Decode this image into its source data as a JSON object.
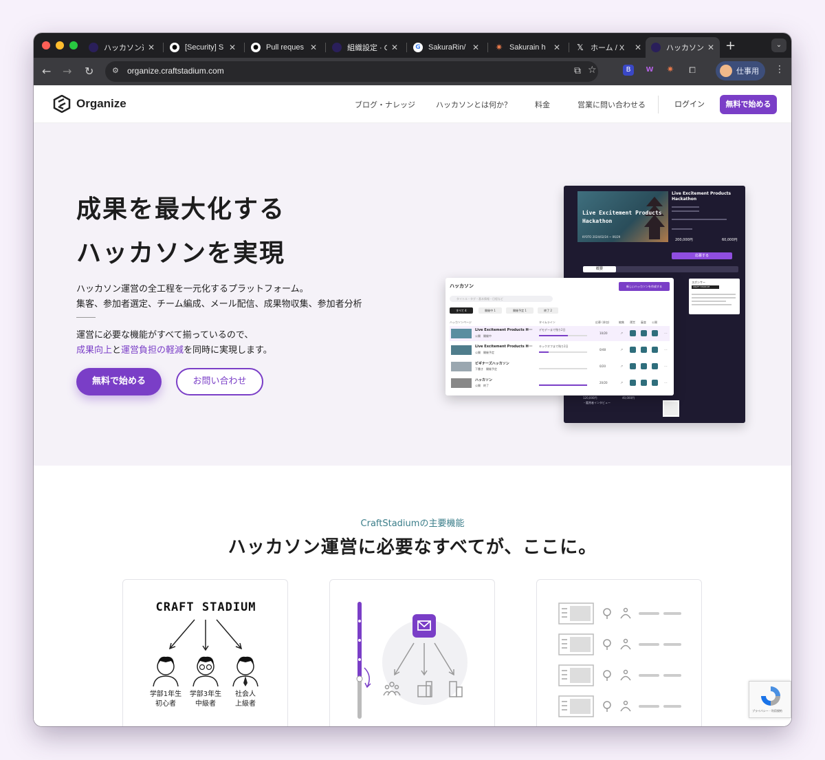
{
  "browser": {
    "tabs": [
      {
        "label": "ハッカソン運",
        "favicon_color": "#2a1f5a"
      },
      {
        "label": "[Security] S",
        "favicon_color": "#ffffff"
      },
      {
        "label": "Pull reques",
        "favicon_color": "#ffffff"
      },
      {
        "label": "組織設定 · C",
        "favicon_color": "#2a1f5a"
      },
      {
        "label": "SakuraRin/",
        "favicon_color": "#ffffff"
      },
      {
        "label": "Sakurain h",
        "favicon_color": "#e8794a"
      },
      {
        "label": "ホーム / X",
        "favicon_color": "#ffffff"
      },
      {
        "label": "ハッカソン運",
        "favicon_color": "#2a1f5a"
      }
    ],
    "active_tab_index": 7,
    "url": "organize.craftstadium.com",
    "profile_label": "仕事用"
  },
  "site": {
    "logo_text": "Organize",
    "nav": [
      "ブログ・ナレッジ",
      "ハッカソンとは何か？",
      "料金",
      "営業に問い合わせる"
    ],
    "login_label": "ログイン",
    "signup_label": "無料で始める",
    "accent_color": "#7a3ec7"
  },
  "hero": {
    "title_line1": "成果を最大化する",
    "title_line2": "ハッカソンを実現",
    "desc_line1": "ハッカソン運営の全工程を一元化するプラットフォーム。",
    "desc_line2": "集客、参加者選定、チーム編成、メール配信、成果物収集、参加者分析",
    "benefit_line1": "運営に必要な機能がすべて揃っているので、",
    "benefit_part_a": "成果向上",
    "benefit_part_b": "と",
    "benefit_part_c": "運営負担の軽減",
    "benefit_part_d": "を同時に実現します。",
    "cta_primary": "無料で始める",
    "cta_secondary": "お問い合わせ"
  },
  "mock_event": {
    "banner_text": "Live Excitement Products Hackathon",
    "title": "Live Excitement Products Hackathon",
    "join_label": "応募する",
    "tab_overview": "概要",
    "prize_1": "200,000円",
    "prize_2": "60,000円",
    "bottom_1": "120,000円",
    "bottom_2": "40,000円",
    "side_title": "スポンサー",
    "side_brand": "CRAFT STADIUM",
    "interview": "・鑑賞者インタビュー",
    "hold_date": "KYOTO 2024/02/24 ~ 06/29"
  },
  "mock_list": {
    "title": "ハッカソン",
    "new_button": "新しいハッカソンを作成する",
    "search_placeholder": "タイトル・タグ・基本情報・日程など",
    "filters": [
      "すべて 4",
      "開催中 1",
      "開催予定 1",
      "終了 2"
    ],
    "headers": [
      "ハッカソンページ",
      "タイムライン",
      "応募 (参加)",
      "編集",
      "運営",
      "審査",
      "公開"
    ],
    "rows": [
      {
        "name": "Live Excitement Products H···",
        "sub": "公開　開催中",
        "status": "デモデーまで残り2日",
        "count": "10/20",
        "progress": 0.6
      },
      {
        "name": "Live Excitement Products H···",
        "sub": "公開　開催予定",
        "status": "キックオフまで残り2日",
        "count": "0/48",
        "progress": 0.2
      },
      {
        "name": "ビギナーズハッカソン",
        "sub": "下書き　開催予定",
        "status": "",
        "count": "0/20",
        "progress": 0.0
      },
      {
        "name": "ハッカソン",
        "sub": "公開　終了",
        "status": "",
        "count": "20/20",
        "progress": 1.0
      }
    ]
  },
  "features": {
    "eyebrow": "CraftStadiumの主要機能",
    "title": "ハッカソン運営に必要なすべてが、ここに。",
    "card1_brand": "CRAFT STADIUM",
    "card1_people": [
      {
        "line1": "学部1年生",
        "line2": "初心者"
      },
      {
        "line1": "学部3年生",
        "line2": "中級者"
      },
      {
        "line1": "社会人",
        "line2": "上級者"
      }
    ]
  },
  "recaptcha": {
    "label": "プライバシー - 利用規約"
  }
}
